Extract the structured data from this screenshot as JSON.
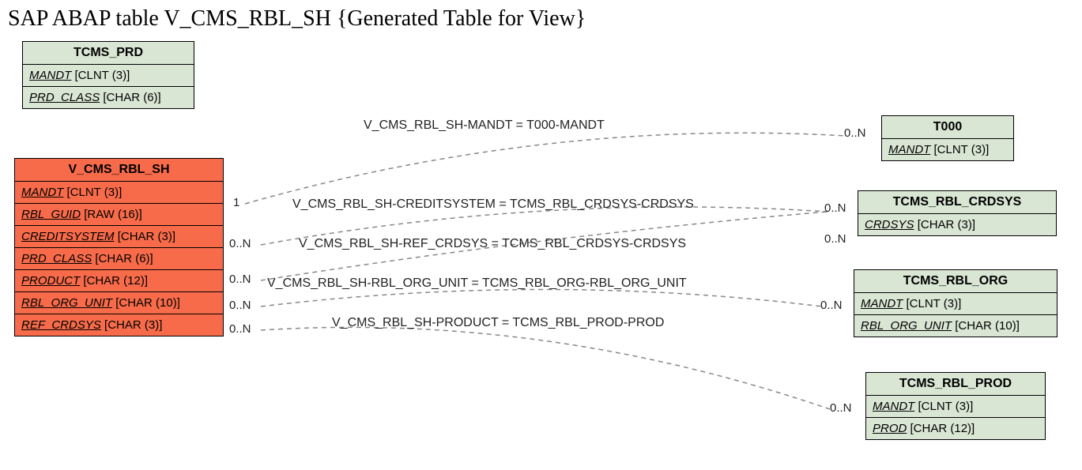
{
  "title": "SAP ABAP table V_CMS_RBL_SH {Generated Table for View}",
  "entities": {
    "tcms_prd": {
      "name": "TCMS_PRD",
      "fields": [
        {
          "name": "MANDT",
          "type": "[CLNT (3)]"
        },
        {
          "name": "PRD_CLASS",
          "type": "[CHAR (6)]"
        }
      ]
    },
    "v_cms_rbl_sh": {
      "name": "V_CMS_RBL_SH",
      "fields": [
        {
          "name": "MANDT",
          "type": "[CLNT (3)]"
        },
        {
          "name": "RBL_GUID",
          "type": "[RAW (16)]"
        },
        {
          "name": "CREDITSYSTEM",
          "type": "[CHAR (3)]"
        },
        {
          "name": "PRD_CLASS",
          "type": "[CHAR (6)]"
        },
        {
          "name": "PRODUCT",
          "type": "[CHAR (12)]"
        },
        {
          "name": "RBL_ORG_UNIT",
          "type": "[CHAR (10)]"
        },
        {
          "name": "REF_CRDSYS",
          "type": "[CHAR (3)]"
        }
      ]
    },
    "t000": {
      "name": "T000",
      "fields": [
        {
          "name": "MANDT",
          "type": "[CLNT (3)]"
        }
      ]
    },
    "tcms_rbl_crdsys": {
      "name": "TCMS_RBL_CRDSYS",
      "fields": [
        {
          "name": "CRDSYS",
          "type": "[CHAR (3)]"
        }
      ]
    },
    "tcms_rbl_org": {
      "name": "TCMS_RBL_ORG",
      "fields": [
        {
          "name": "MANDT",
          "type": "[CLNT (3)]"
        },
        {
          "name": "RBL_ORG_UNIT",
          "type": "[CHAR (10)]"
        }
      ]
    },
    "tcms_rbl_prod": {
      "name": "TCMS_RBL_PROD",
      "fields": [
        {
          "name": "MANDT",
          "type": "[CLNT (3)]"
        },
        {
          "name": "PROD",
          "type": "[CHAR (12)]"
        }
      ]
    }
  },
  "relations": [
    {
      "label": "V_CMS_RBL_SH-MANDT = T000-MANDT",
      "left_card": "1",
      "right_card": "0..N"
    },
    {
      "label": "V_CMS_RBL_SH-CREDITSYSTEM = TCMS_RBL_CRDSYS-CRDSYS",
      "left_card": "0..N",
      "right_card": "0..N"
    },
    {
      "label": "V_CMS_RBL_SH-REF_CRDSYS = TCMS_RBL_CRDSYS-CRDSYS",
      "left_card": "0..N",
      "right_card": "0..N"
    },
    {
      "label": "V_CMS_RBL_SH-RBL_ORG_UNIT = TCMS_RBL_ORG-RBL_ORG_UNIT",
      "left_card": "0..N",
      "right_card": "0..N"
    },
    {
      "label": "V_CMS_RBL_SH-PRODUCT = TCMS_RBL_PROD-PROD",
      "left_card": "0..N",
      "right_card": "0..N"
    }
  ]
}
